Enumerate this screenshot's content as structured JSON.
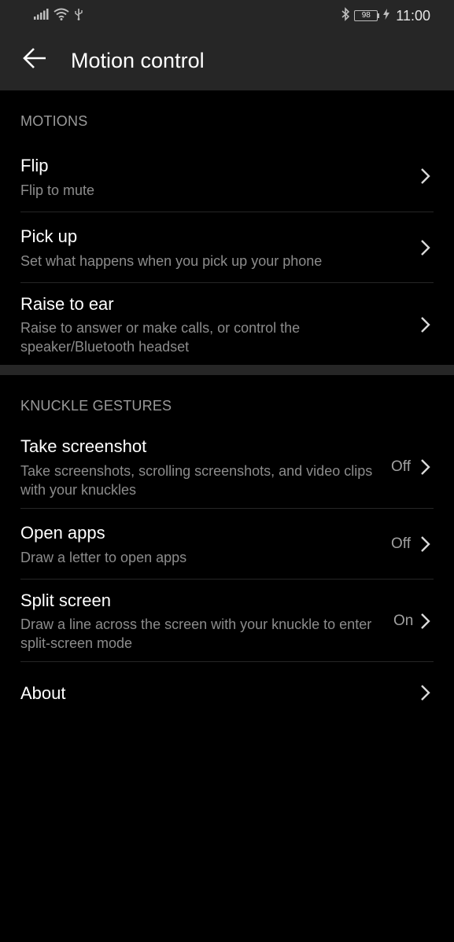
{
  "status_bar": {
    "time": "11:00",
    "battery_level": "98",
    "icons": [
      "signal-icon",
      "wifi-icon",
      "usb-icon",
      "bluetooth-icon",
      "battery-icon",
      "charging-icon"
    ]
  },
  "header": {
    "title": "Motion control",
    "back_icon": "arrow-left-icon"
  },
  "sections": {
    "motions": {
      "header": "MOTIONS",
      "items": [
        {
          "title": "Flip",
          "subtitle": "Flip to mute"
        },
        {
          "title": "Pick up",
          "subtitle": "Set what happens when you pick up your phone"
        },
        {
          "title": "Raise to ear",
          "subtitle": "Raise to answer or make calls, or control the speaker/Bluetooth headset"
        }
      ]
    },
    "knuckle": {
      "header": "KNUCKLE GESTURES",
      "items": [
        {
          "title": "Take screenshot",
          "subtitle": "Take screenshots, scrolling screenshots, and video clips with your knuckles",
          "value": "Off"
        },
        {
          "title": "Open apps",
          "subtitle": "Draw a letter to open apps",
          "value": "Off"
        },
        {
          "title": "Split screen",
          "subtitle": "Draw a line across the screen with your knuckle to enter split-screen mode",
          "value": "On"
        }
      ]
    },
    "about": {
      "title": "About"
    }
  },
  "colors": {
    "background": "#000000",
    "appbar": "#262626",
    "primary_text": "#ffffff",
    "secondary_text": "#8c8c8c",
    "section_header": "#9a9a9a"
  }
}
